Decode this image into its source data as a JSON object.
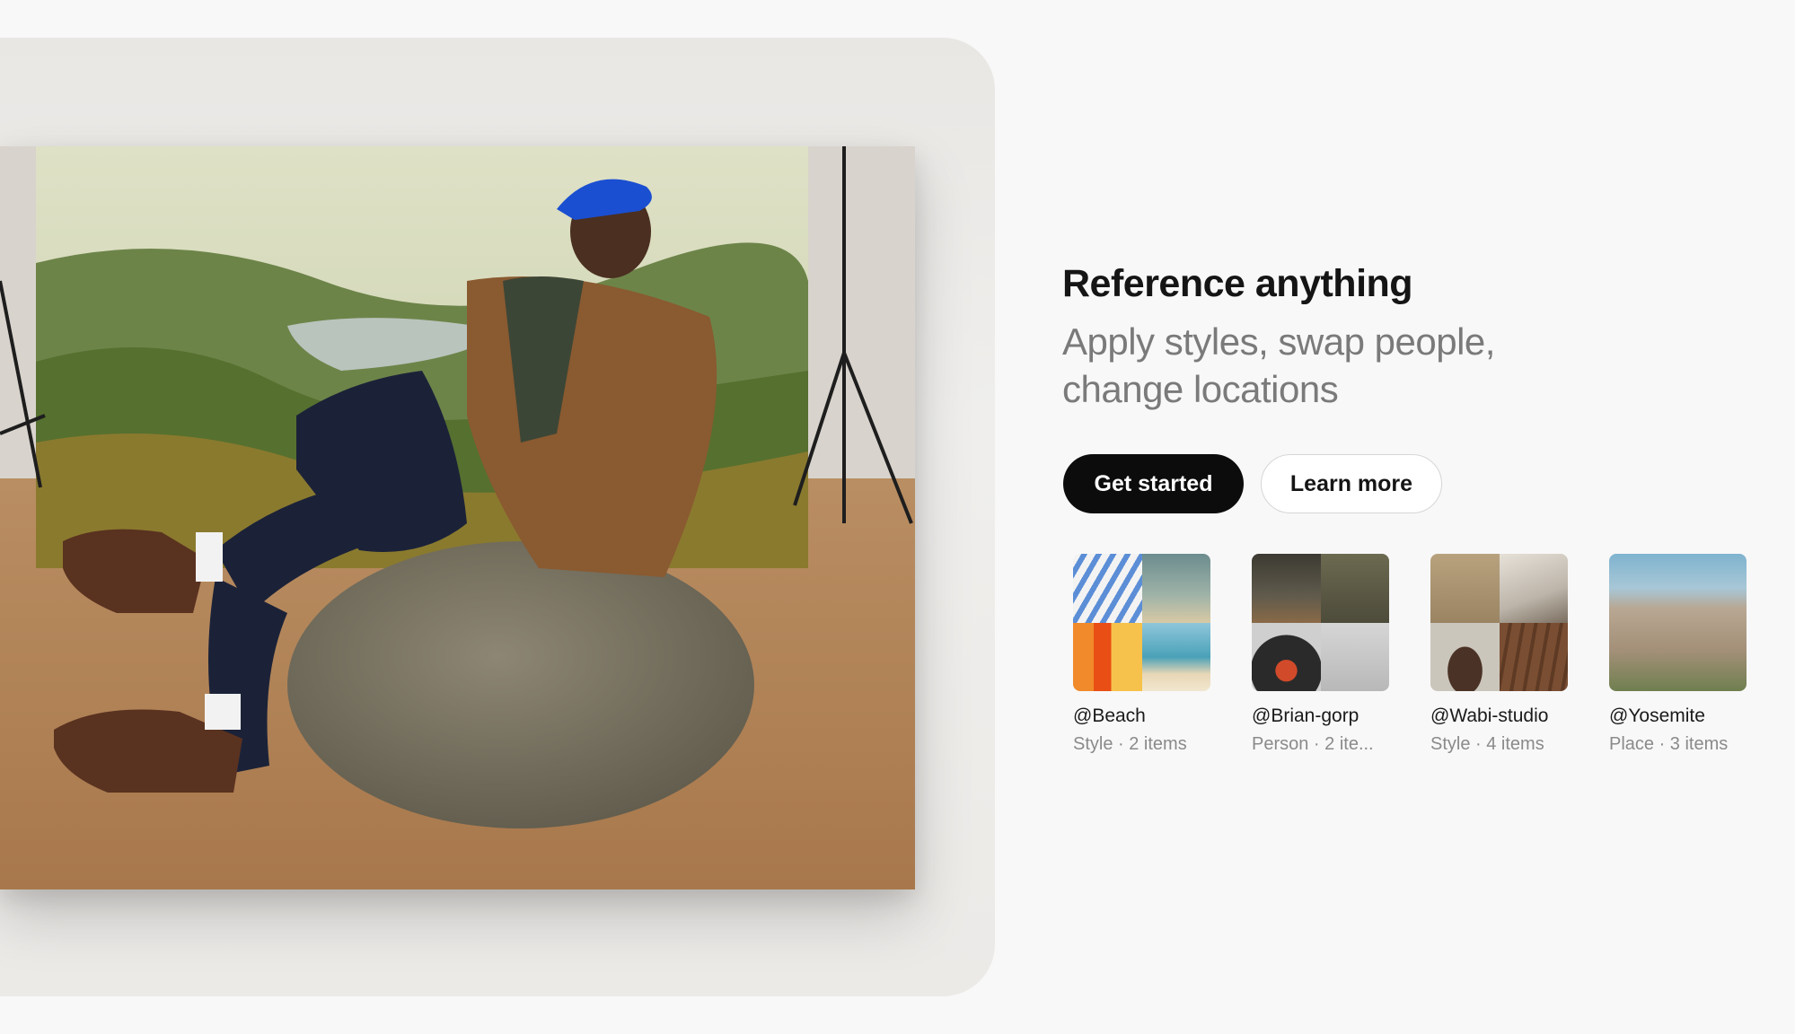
{
  "hero": {
    "headline": "Reference anything",
    "subhead": "Apply styles, swap people, change locations",
    "primary_button": "Get started",
    "secondary_button": "Learn more"
  },
  "references": [
    {
      "name": "@Beach",
      "meta": "Style · 2 items"
    },
    {
      "name": "@Brian-gorp",
      "meta": "Person · 2 ite..."
    },
    {
      "name": "@Wabi-studio",
      "meta": "Style · 4 items"
    },
    {
      "name": "@Yosemite",
      "meta": "Place · 3 items"
    }
  ],
  "colors": {
    "background": "#f8f8f8",
    "primary_button": "#0c0c0c",
    "headline": "#151515",
    "subhead": "#7a7a7a"
  }
}
